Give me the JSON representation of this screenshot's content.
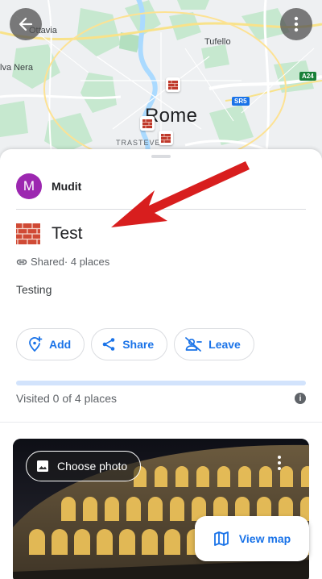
{
  "map": {
    "labels": {
      "ottavia": "Ottavia",
      "tufello": "Tufello",
      "mudit": "Mudit",
      "valle_nera": "lva Nera",
      "rome": "Rome",
      "trastevere": "TRASTEVERE"
    },
    "road_shields": {
      "sr5": "SR5",
      "a24": "A24"
    }
  },
  "owner": {
    "initial": "M",
    "name": "Mudit"
  },
  "list": {
    "title": "Test",
    "shared_label": "Shared",
    "places_label": " · 4 places",
    "description": "Testing"
  },
  "actions": {
    "add": "Add",
    "share": "Share",
    "leave": "Leave"
  },
  "progress": {
    "visited_text": "Visited 0 of 4 places",
    "fraction": 0
  },
  "place_card": {
    "choose_photo": "Choose photo"
  },
  "view_map": "View map",
  "colors": {
    "accent": "#1a73e8",
    "avatar": "#9c27b0",
    "annotation_arrow": "#e02020"
  }
}
